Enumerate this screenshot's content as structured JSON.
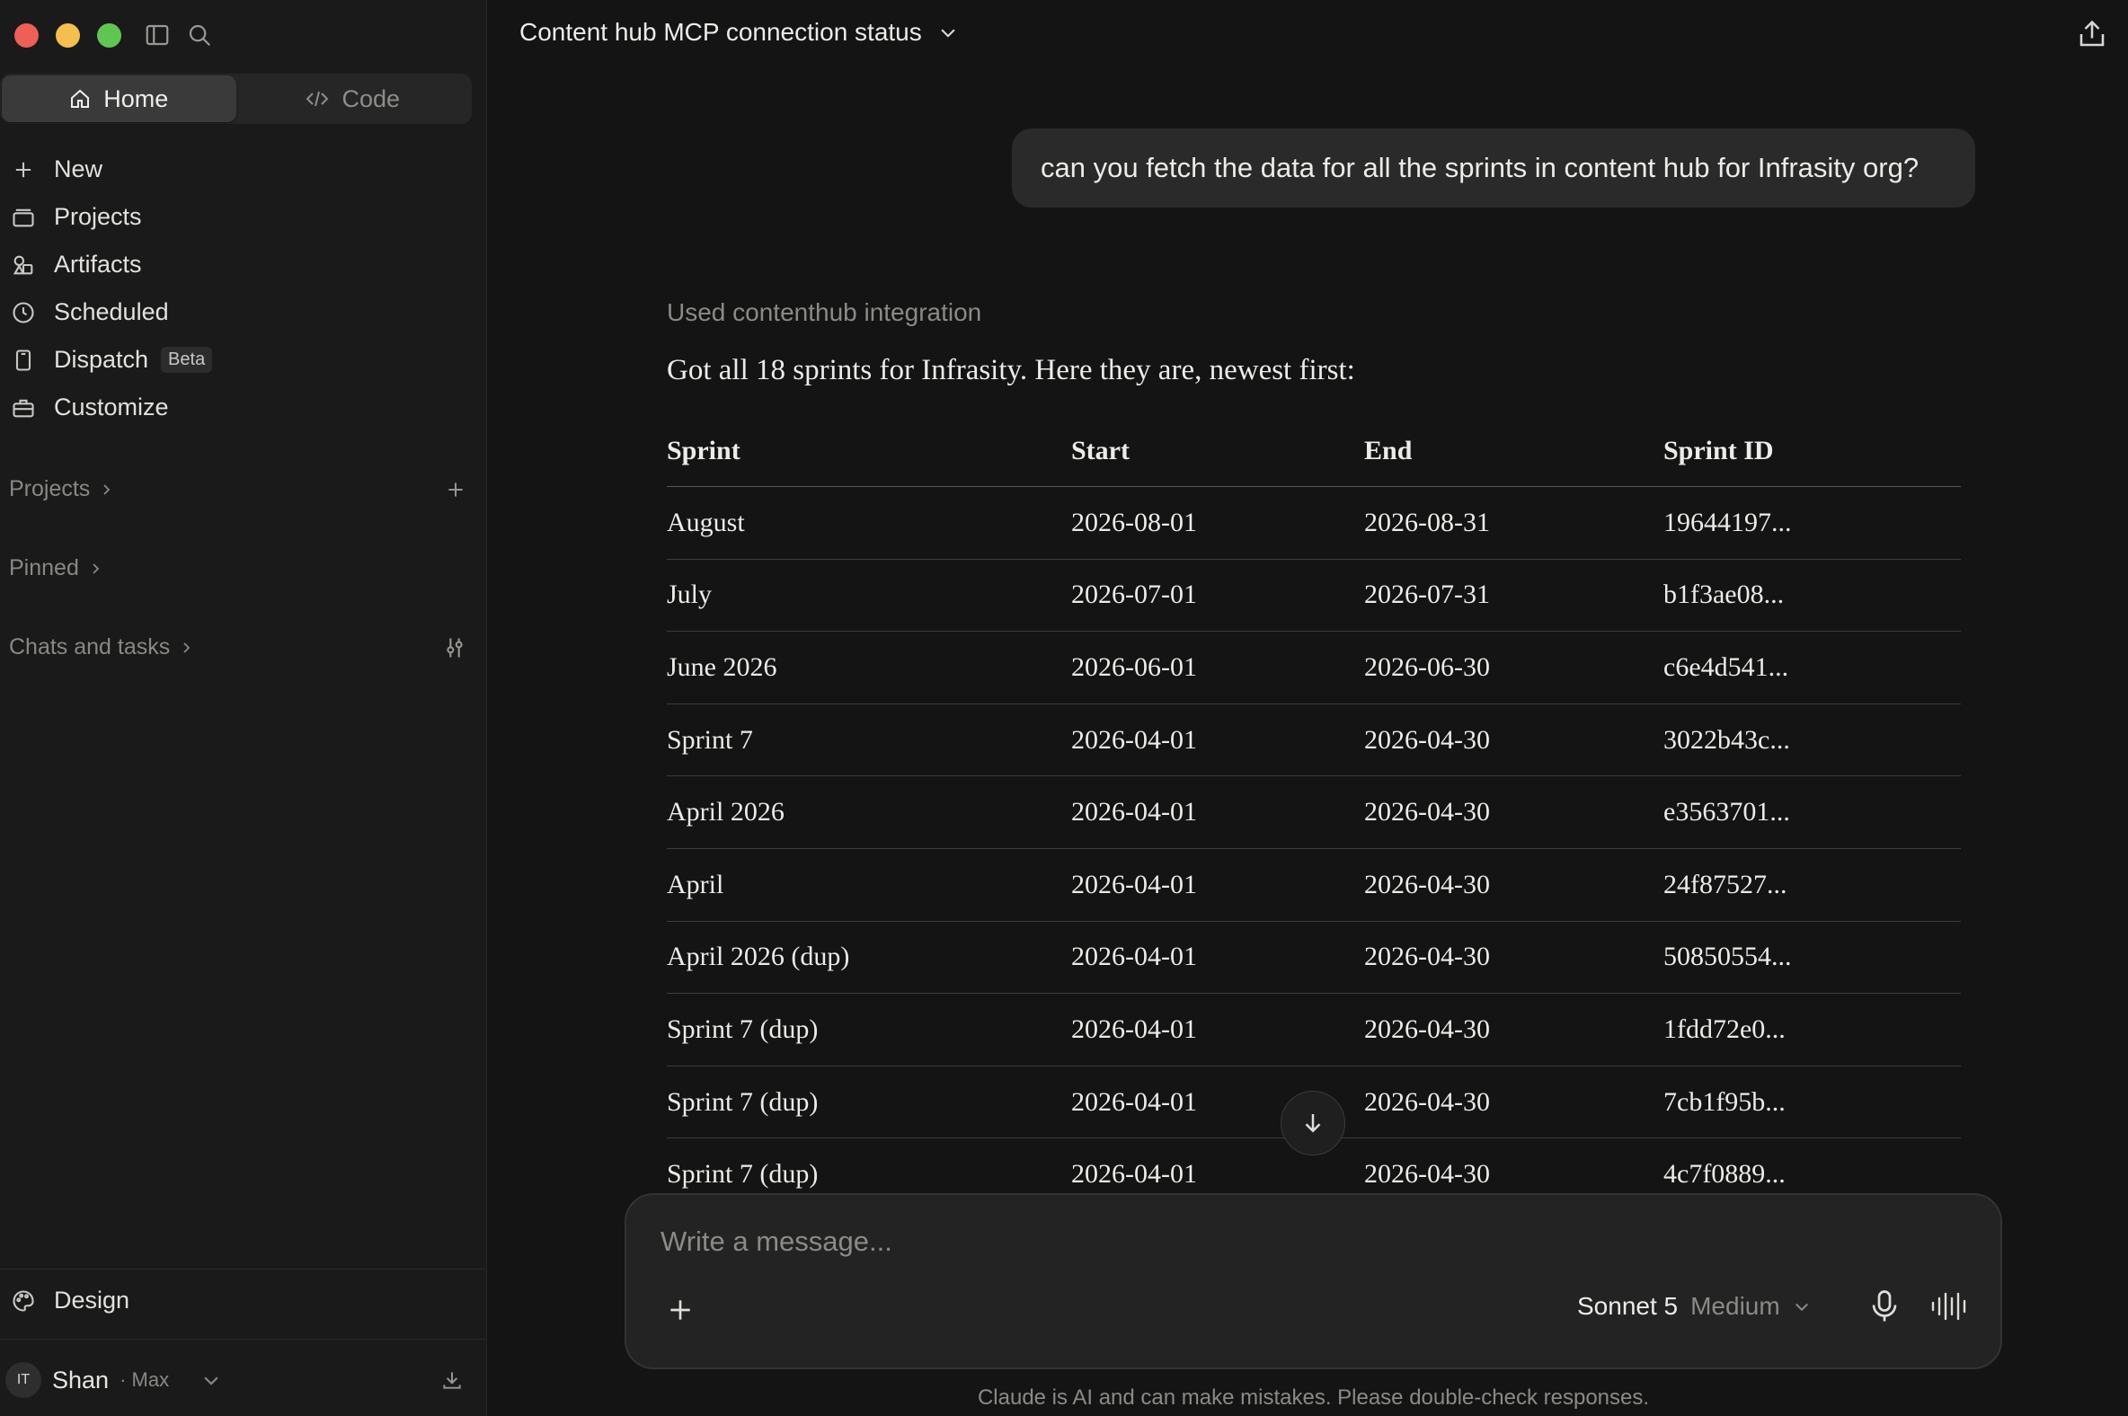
{
  "sidebar": {
    "tabs": {
      "home": "Home",
      "code": "Code"
    },
    "nav": [
      {
        "label": "New",
        "icon": "plus-icon"
      },
      {
        "label": "Projects",
        "icon": "folder-icon"
      },
      {
        "label": "Artifacts",
        "icon": "shapes-icon"
      },
      {
        "label": "Scheduled",
        "icon": "clock-icon"
      },
      {
        "label": "Dispatch",
        "icon": "phone-icon",
        "badge": "Beta"
      },
      {
        "label": "Customize",
        "icon": "briefcase-icon"
      }
    ],
    "sections": {
      "projects": "Projects",
      "pinned": "Pinned",
      "chats": "Chats and tasks"
    },
    "design": "Design",
    "user": {
      "initials": "IT",
      "name": "Shan",
      "plan": "· Max"
    }
  },
  "header": {
    "title": "Content hub MCP connection status"
  },
  "conversation": {
    "user_message": "can you fetch the data for all the sprints in content hub for Infrasity org?",
    "tool_used": "Used contenthub integration",
    "reply_intro": "Got all 18 sprints for Infrasity. Here they are, newest first:"
  },
  "table": {
    "headers": [
      "Sprint",
      "Start",
      "End",
      "Sprint ID"
    ],
    "rows": [
      [
        "August",
        "2026-08-01",
        "2026-08-31",
        "19644197..."
      ],
      [
        "July",
        "2026-07-01",
        "2026-07-31",
        "b1f3ae08..."
      ],
      [
        "June 2026",
        "2026-06-01",
        "2026-06-30",
        "c6e4d541..."
      ],
      [
        "Sprint 7",
        "2026-04-01",
        "2026-04-30",
        "3022b43c..."
      ],
      [
        "April 2026",
        "2026-04-01",
        "2026-04-30",
        "e3563701..."
      ],
      [
        "April",
        "2026-04-01",
        "2026-04-30",
        "24f87527..."
      ],
      [
        "April 2026 (dup)",
        "2026-04-01",
        "2026-04-30",
        "50850554..."
      ],
      [
        "Sprint 7 (dup)",
        "2026-04-01",
        "2026-04-30",
        "1fdd72e0..."
      ],
      [
        "Sprint 7 (dup)",
        "2026-04-01",
        "2026-04-30",
        "7cb1f95b..."
      ],
      [
        "Sprint 7 (dup)",
        "2026-04-01",
        "2026-04-30",
        "4c7f0889..."
      ]
    ]
  },
  "composer": {
    "placeholder": "Write a message...",
    "model": "Sonnet 5",
    "effort": "Medium"
  },
  "disclaimer": "Claude is AI and can make mistakes. Please double-check responses."
}
